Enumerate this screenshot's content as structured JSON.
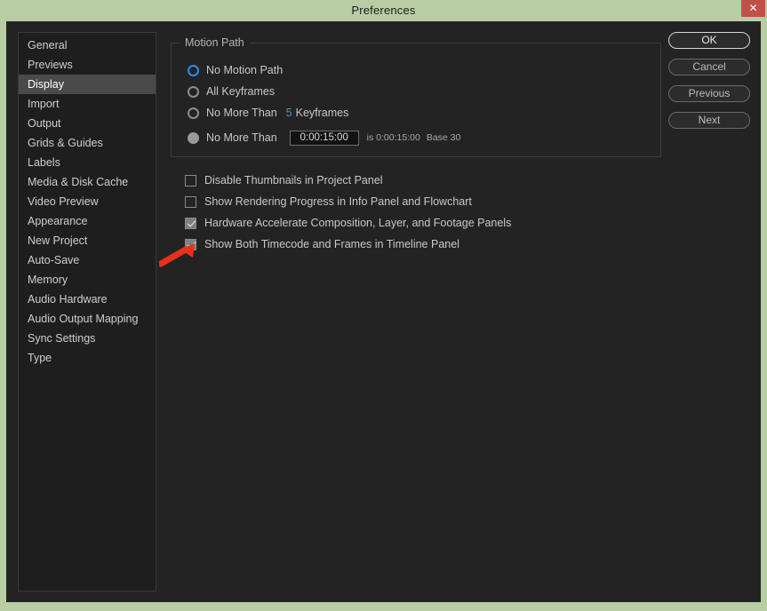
{
  "window": {
    "title": "Preferences",
    "close_label": "✕",
    "titlebar_color": "#b9cda5",
    "close_color": "#c0504a",
    "dialog_bg": "#232323"
  },
  "sidebar": {
    "selected": "Display",
    "items": [
      {
        "label": "General"
      },
      {
        "label": "Previews"
      },
      {
        "label": "Display"
      },
      {
        "label": "Import"
      },
      {
        "label": "Output"
      },
      {
        "label": "Grids & Guides"
      },
      {
        "label": "Labels"
      },
      {
        "label": "Media & Disk Cache"
      },
      {
        "label": "Video Preview"
      },
      {
        "label": "Appearance"
      },
      {
        "label": "New Project"
      },
      {
        "label": "Auto-Save"
      },
      {
        "label": "Memory"
      },
      {
        "label": "Audio Hardware"
      },
      {
        "label": "Audio Output Mapping"
      },
      {
        "label": "Sync Settings"
      },
      {
        "label": "Type"
      }
    ]
  },
  "main": {
    "motion_path": {
      "legend": "Motion Path",
      "accent_color": "#2a8cf0",
      "options": [
        {
          "label": "No Motion Path",
          "state": "checked"
        },
        {
          "label": "All Keyframes",
          "state": "unchecked"
        },
        {
          "label": "No More Than",
          "state": "unchecked",
          "value": "5",
          "suffix": "Keyframes"
        },
        {
          "label": "No More Than",
          "state": "disc"
        }
      ],
      "timecode": {
        "value": "0:00:15:00",
        "placeholder": "0:00:00:00",
        "note_prefix": "is 0:00:15:00",
        "note_base": "Base 30"
      }
    },
    "checkboxes": [
      {
        "label": "Disable Thumbnails in Project Panel",
        "checked": false
      },
      {
        "label": "Show Rendering Progress in Info Panel and Flowchart",
        "checked": false
      },
      {
        "label": "Hardware Accelerate Composition, Layer, and Footage Panels",
        "checked": true
      },
      {
        "label": "Show Both Timecode and Frames in Timeline Panel",
        "checked": true
      }
    ]
  },
  "buttons": [
    {
      "label": "OK",
      "primary": true
    },
    {
      "label": "Cancel",
      "primary": false
    },
    {
      "label": "Previous",
      "primary": false
    },
    {
      "label": "Next",
      "primary": false
    }
  ],
  "annotation": {
    "arrow_color": "#e8311a",
    "points_to": "Hardware Accelerate Composition, Layer, and Footage Panels"
  }
}
